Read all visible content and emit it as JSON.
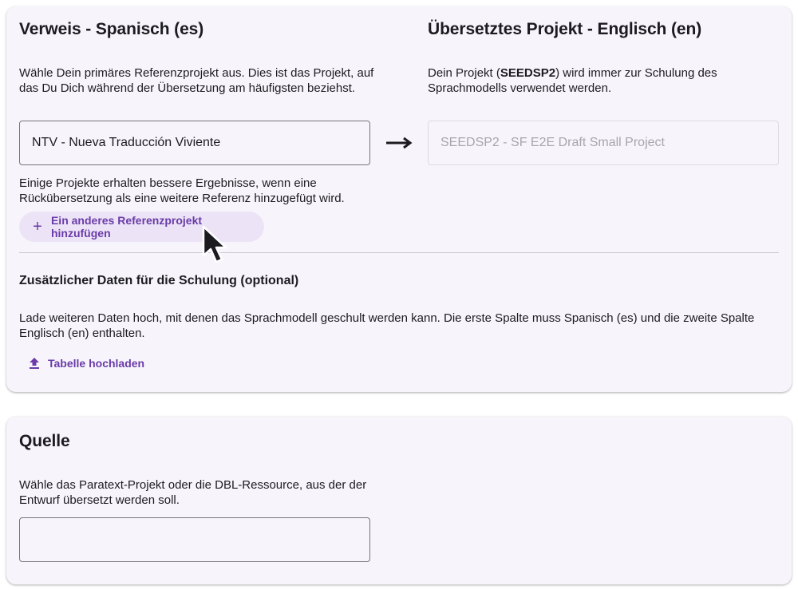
{
  "reference": {
    "title": "Verweis - Spanisch (es)",
    "description": "Wähle Dein primäres Referenzprojekt aus. Dies ist das Projekt, auf das Du Dich während der Übersetzung am häufigsten beziehst.",
    "selected_project": "NTV - Nueva Traducción Viviente",
    "hint": "Einige Projekte erhalten bessere Ergebnisse, wenn eine Rückübersetzung als eine weitere Referenz hinzugefügt wird.",
    "add_button_label": "Ein anderes Referenzprojekt hinzufügen"
  },
  "target": {
    "title": "Übersetztes Projekt - Englisch (en)",
    "description_prefix": "Dein Projekt (",
    "project_code": "SEEDSP2",
    "description_suffix": ") wird immer zur Schulung des Sprachmodells verwendet werden.",
    "project_value": "SEEDSP2 - SF E2E Draft Small Project"
  },
  "additional": {
    "title": "Zusätzlicher Daten für die Schulung (optional)",
    "description": "Lade weiteren Daten hoch, mit denen das Sprachmodell geschult werden kann. Die erste Spalte muss Spanisch (es) und die zweite Spalte Englisch (en) enthalten.",
    "upload_label": "Tabelle hochladen"
  },
  "source": {
    "title": "Quelle",
    "description": "Wähle das Paratext-Projekt oder die DBL-Ressource, aus der der Entwurf übersetzt werden soll.",
    "value": ""
  },
  "icons": {
    "add": "plus-icon",
    "upload": "upload-icon",
    "arrow": "arrow-right-icon",
    "cursor": "mouse-pointer-icon"
  },
  "colors": {
    "accent": "#6a3ba9",
    "card_background": "#f7f5fb",
    "tonal_button": "#ece4f6"
  }
}
